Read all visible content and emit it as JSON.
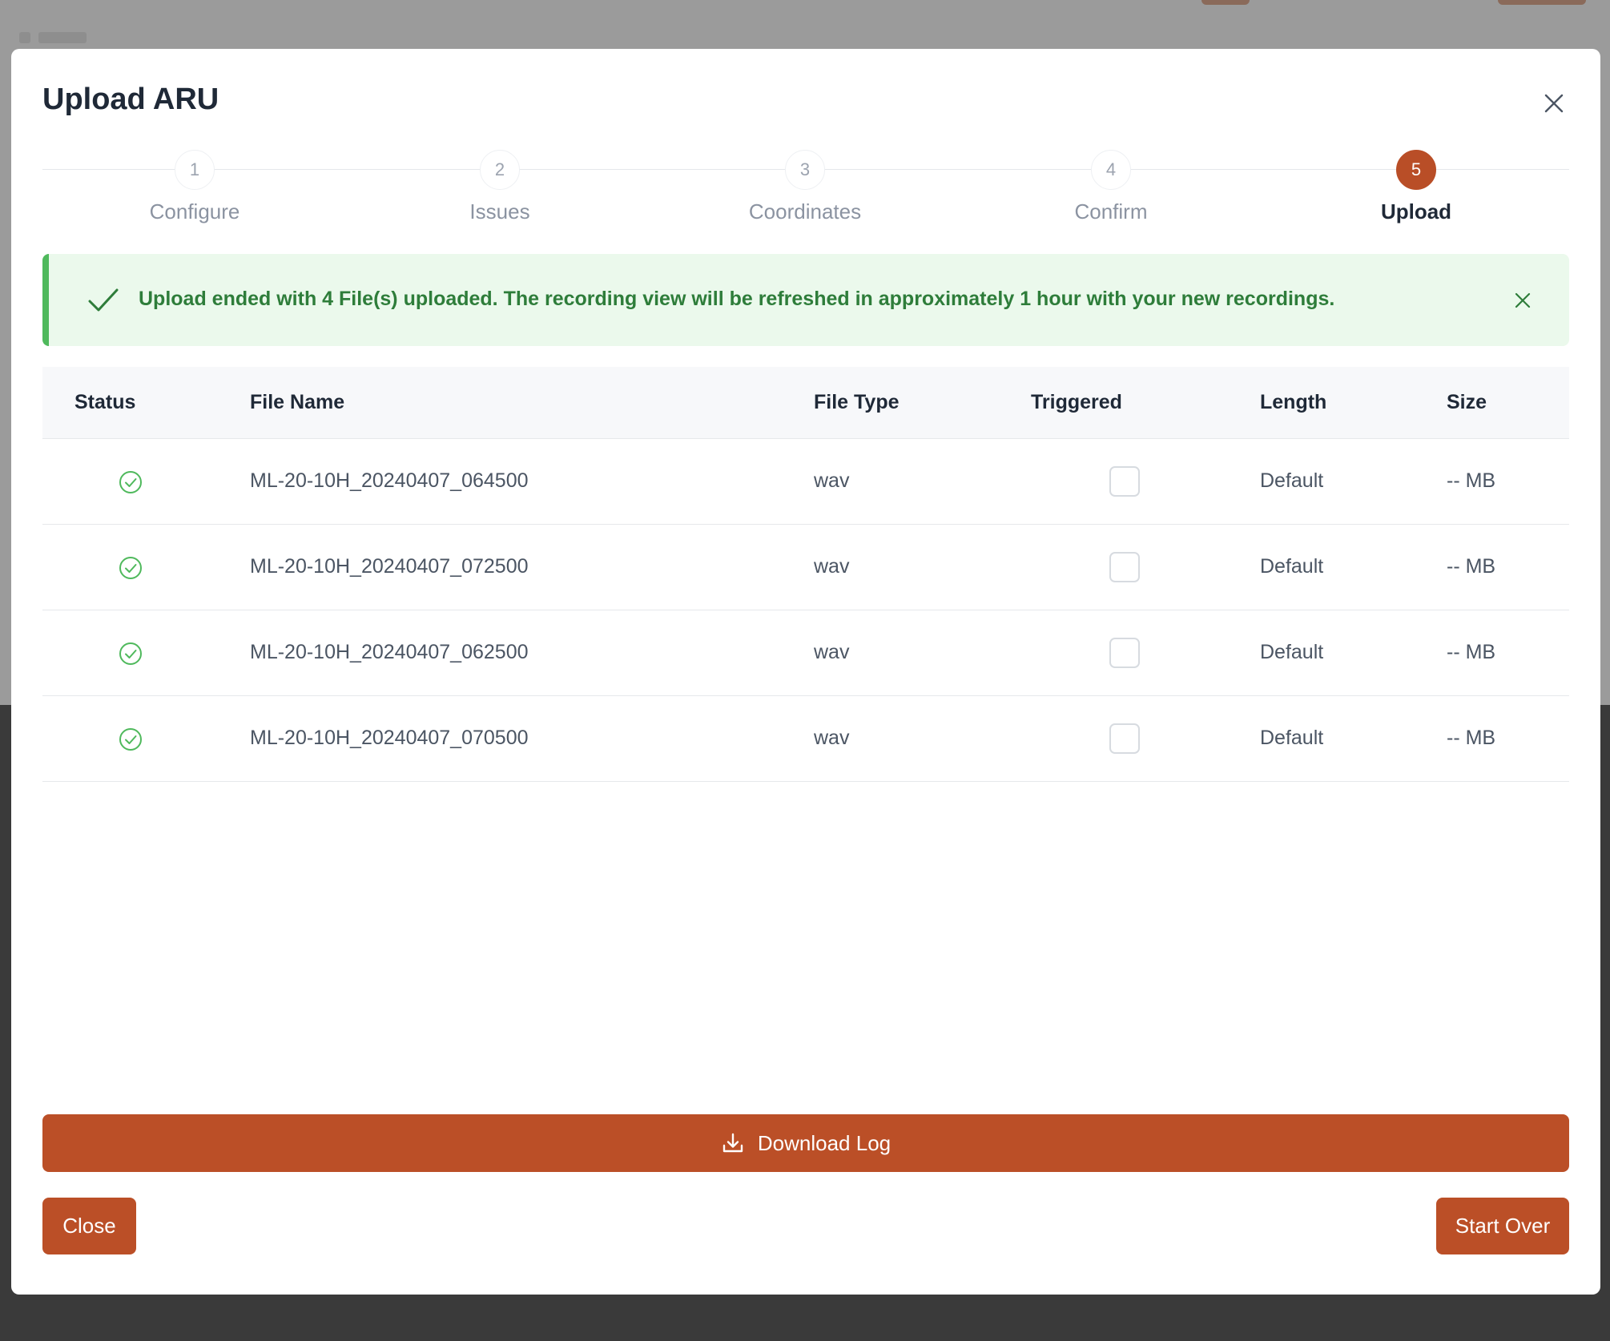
{
  "modal": {
    "title": "Upload ARU"
  },
  "stepper": {
    "active_step": 5,
    "steps": [
      {
        "number": "1",
        "label": "Configure"
      },
      {
        "number": "2",
        "label": "Issues"
      },
      {
        "number": "3",
        "label": "Coordinates"
      },
      {
        "number": "4",
        "label": "Confirm"
      },
      {
        "number": "5",
        "label": "Upload"
      }
    ]
  },
  "alert": {
    "message": "Upload ended with 4 File(s) uploaded. The recording view will be refreshed in approximately 1 hour with your new recordings.",
    "icon": "check-icon"
  },
  "table": {
    "columns": [
      "Status",
      "File Name",
      "File Type",
      "Triggered",
      "Length",
      "Size"
    ],
    "rows": [
      {
        "status": "success",
        "file_name": "ML-20-10H_20240407_064500",
        "file_type": "wav",
        "triggered": false,
        "length": "Default",
        "size": "-- MB"
      },
      {
        "status": "success",
        "file_name": "ML-20-10H_20240407_072500",
        "file_type": "wav",
        "triggered": false,
        "length": "Default",
        "size": "-- MB"
      },
      {
        "status": "success",
        "file_name": "ML-20-10H_20240407_062500",
        "file_type": "wav",
        "triggered": false,
        "length": "Default",
        "size": "-- MB"
      },
      {
        "status": "success",
        "file_name": "ML-20-10H_20240407_070500",
        "file_type": "wav",
        "triggered": false,
        "length": "Default",
        "size": "-- MB"
      }
    ]
  },
  "buttons": {
    "download_log": "Download Log",
    "close": "Close",
    "start_over": "Start Over"
  },
  "colors": {
    "accent": "#bb4f27",
    "success": "#4fb95c",
    "success_text": "#2e7d3a",
    "alert_bg": "#ebf9ec"
  }
}
